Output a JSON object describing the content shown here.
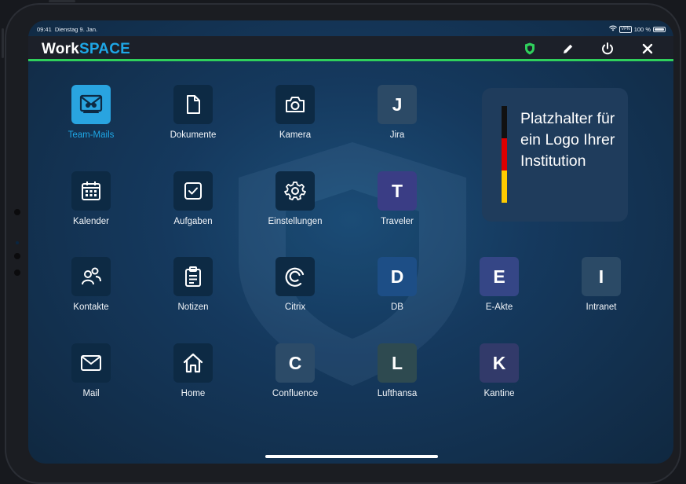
{
  "status": {
    "time": "09:41",
    "date": "Dienstag 9. Jan.",
    "vpn": "VPN",
    "battery": "100 %"
  },
  "header": {
    "brand_work": "Work",
    "brand_space": "SPACE",
    "shield_color": "#2fd05c",
    "icons": [
      "shield-icon",
      "edit-pencil-icon",
      "power-icon",
      "close-icon"
    ]
  },
  "apps": {
    "team_mails": "Team-Mails",
    "dokumente": "Dokumente",
    "kamera": "Kamera",
    "jira": "Jira",
    "jira_letter": "J",
    "kalender": "Kalender",
    "aufgaben": "Aufgaben",
    "einstellungen": "Einstellungen",
    "traveler": "Traveler",
    "traveler_letter": "T",
    "kontakte": "Kontakte",
    "notizen": "Notizen",
    "citrix": "Citrix",
    "db": "DB",
    "db_letter": "D",
    "eakte": "E-Akte",
    "eakte_letter": "E",
    "intranet": "Intranet",
    "intranet_letter": "I",
    "mail": "Mail",
    "home": "Home",
    "confluence": "Confluence",
    "confluence_letter": "C",
    "lufthansa": "Lufthansa",
    "lufthansa_letter": "L",
    "kantine": "Kantine",
    "kantine_letter": "K"
  },
  "logo_placeholder": {
    "line1": "Platzhalter für",
    "line2": "ein Logo Ihrer",
    "line3": "Institution"
  },
  "colors": {
    "accent": "#1ea7e6",
    "flag_black": "#111111",
    "flag_red": "#dd0000",
    "flag_gold": "#ffcc00"
  }
}
